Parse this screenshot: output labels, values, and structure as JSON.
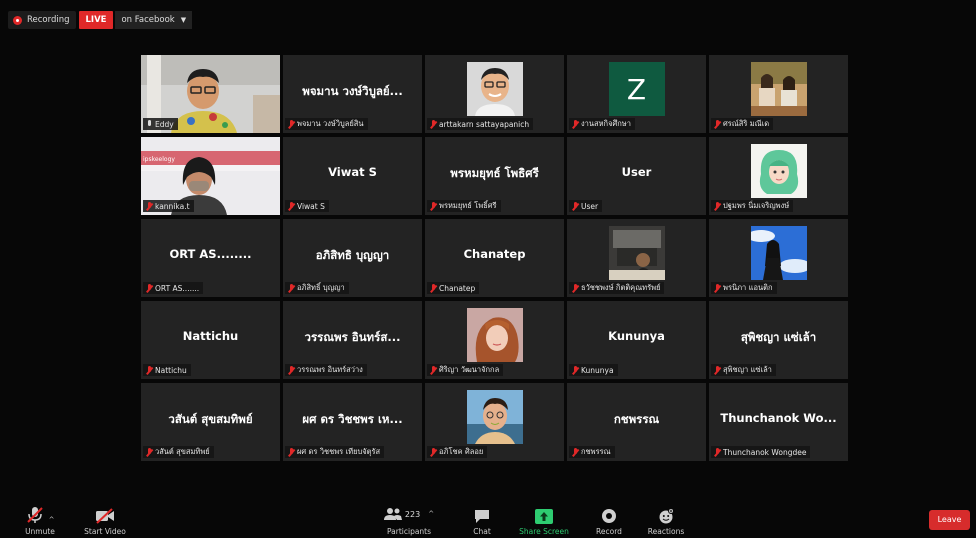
{
  "topbar": {
    "recording": "Recording",
    "live": "LIVE",
    "stream_target": "on Facebook"
  },
  "tiles": [
    {
      "name": "",
      "label": "Eddy",
      "video": "eddy",
      "mic": "on",
      "active": true
    },
    {
      "name": "พจมาน วงษ์วิบูลย์...",
      "label": "พจมาน วงษ์วิบูลย์สิน"
    },
    {
      "name": "",
      "label": "arttakarn sattayapanich",
      "pic": "man-portrait"
    },
    {
      "name": "",
      "label": "งานสหกิจศึกษา",
      "pic": "z"
    },
    {
      "name": "",
      "label": "ศรณ์สิริ มณีเด",
      "pic": "outdoor"
    },
    {
      "name": "",
      "label": "kannika.t",
      "video": "kannika"
    },
    {
      "name": "Viwat S",
      "label": "Viwat S"
    },
    {
      "name": "พรหมยุทธ์ โพธิศรี",
      "label": "พรหมยุทธ์ โพธิ์ศรี"
    },
    {
      "name": "User",
      "label": "User"
    },
    {
      "name": "",
      "label": "ปฐมพร นิ่มเจริญพงษ์",
      "pic": "drawing"
    },
    {
      "name": "ORT AS........",
      "label": "ORT AS......."
    },
    {
      "name": "อภิสิทธิ บุญญา",
      "label": "อภิสิทธิ์ บุญญา"
    },
    {
      "name": "Chanatep",
      "label": "Chanatep"
    },
    {
      "name": "",
      "label": "ธวัชชพงษ์ กิตติคุณทรัพย์",
      "pic": "room"
    },
    {
      "name": "",
      "label": "พรนิภา แอนติก",
      "pic": "sky"
    },
    {
      "name": "Nattichu",
      "label": "Nattichu"
    },
    {
      "name": "วรรณพร อินทร์ส...",
      "label": "วรรณพร อินทร์สว่าง"
    },
    {
      "name": "",
      "label": "ศิริญา วัฒนาจักกล",
      "pic": "girl"
    },
    {
      "name": "Kununya",
      "label": "Kununya"
    },
    {
      "name": "สุพิชญา แซ่เล้า",
      "label": "สุพิชญา แซ่เล้า"
    },
    {
      "name": "วสันต์ สุขสมทิพย์",
      "label": "วสันต์ สุขสมทิพย์"
    },
    {
      "name": "ผศ ดร วิชชพร เห...",
      "label": "ผศ ดร วิชชพร เทียบจัตุรัส"
    },
    {
      "name": "",
      "label": "อภิโชค ศิลอย",
      "pic": "selfie"
    },
    {
      "name": "กชพรรณ",
      "label": "กชพรรณ"
    },
    {
      "name": "Thunchanok Wo...",
      "label": "Thunchanok Wongdee"
    }
  ],
  "toolbar": {
    "unmute": "Unmute",
    "start_video": "Start Video",
    "participants": "Participants",
    "participants_count": "223",
    "chat": "Chat",
    "share_screen": "Share Screen",
    "record": "Record",
    "reactions": "Reactions",
    "leave": "Leave"
  },
  "colors": {
    "live_red": "#e02828",
    "share_green": "#2ecc71",
    "active_outline": "#9acd32",
    "leave_red": "#d72c2c"
  }
}
